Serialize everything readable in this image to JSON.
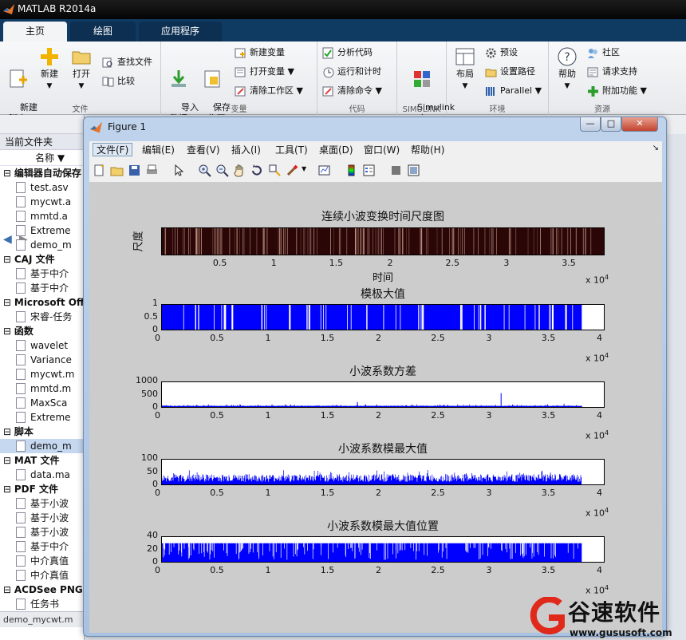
{
  "app": {
    "title": "MATLAB R2014a"
  },
  "tabs": [
    {
      "label": "主页"
    },
    {
      "label": "绘图"
    },
    {
      "label": "应用程序"
    }
  ],
  "ribbon": {
    "file": {
      "group": "文件",
      "new_script": "新建\n脚本",
      "new": "新建",
      "open": "打开",
      "find_files": "查找文件",
      "compare": "比较"
    },
    "variable": {
      "group": "变量",
      "import": "导入\n数据",
      "save_ws": "保存\n工作区",
      "new_var": "新建变量",
      "open_var": "打开变量",
      "clear_ws": "清除工作区"
    },
    "code": {
      "group": "代码",
      "analyze": "分析代码",
      "run_time": "运行和计时",
      "clear_cmd": "清除命令"
    },
    "simulink": {
      "group": "SIMULINK",
      "lib": "Simulink\n库"
    },
    "env": {
      "group": "环境",
      "layout": "布局",
      "prefs": "预设",
      "set_path": "设置路径",
      "parallel": "Parallel"
    },
    "resources": {
      "group": "资源",
      "help": "帮助",
      "community": "社区",
      "support": "请求支持",
      "addons": "附加功能"
    }
  },
  "left_panel": {
    "title": "当前文件夹",
    "col_name": "名称",
    "groups": [
      {
        "name": "编辑器自动保存",
        "files": [
          "test.asv",
          "mycwt.a",
          "mmtd.a",
          "Extreme",
          "demo_m"
        ]
      },
      {
        "name": "CAJ 文件",
        "files": [
          "基于中介",
          "基于中介"
        ]
      },
      {
        "name": "Microsoft Off",
        "files": [
          "宋睿-任务"
        ]
      },
      {
        "name": "函数",
        "files": [
          "wavelet",
          "Variance",
          "mycwt.m",
          "mmtd.m",
          "MaxSca",
          "Extreme"
        ]
      },
      {
        "name": "脚本",
        "files": [
          "demo_m"
        ]
      },
      {
        "name": "MAT 文件",
        "files": [
          "data.ma"
        ]
      },
      {
        "name": "PDF 文件",
        "files": [
          "基于小波",
          "基于小波",
          "基于小波",
          "基于中介",
          "中介真值",
          "中介真值"
        ]
      },
      {
        "name": "ACDSee PNG",
        "files": [
          "任务书"
        ]
      }
    ],
    "status": "demo_mycwt.m"
  },
  "figure": {
    "title": "Figure 1",
    "menu": [
      "文件(F)",
      "编辑(E)",
      "查看(V)",
      "插入(I)",
      "工具(T)",
      "桌面(D)",
      "窗口(W)",
      "帮助(H)"
    ]
  },
  "colors": {
    "plot_blue": "#0000ff",
    "scalogram_bg": "#2a0606",
    "ribbon_tab": "#0f3b63"
  },
  "chart_data": [
    {
      "type": "heatmap",
      "title": "连续小波变换时间尺度图",
      "xlabel": "时间",
      "ylabel": "尺度",
      "xlim": [
        0,
        38000
      ],
      "x_ticks": [
        "0.5",
        "1",
        "1.5",
        "2",
        "2.5",
        "3",
        "3.5"
      ],
      "x_tick_values": [
        5000,
        10000,
        15000,
        20000,
        25000,
        30000,
        35000
      ],
      "x_exponent": "x 10",
      "x_exponent_power": "4"
    },
    {
      "type": "bar",
      "title": "模极大值",
      "xlim": [
        0,
        40000
      ],
      "ylim": [
        0,
        1
      ],
      "y_ticks": [
        "0",
        "0.5",
        "1"
      ],
      "x_ticks": [
        "0",
        "0.5",
        "1",
        "1.5",
        "2",
        "2.5",
        "3",
        "3.5",
        "4"
      ],
      "data_end_x": 38000,
      "gaps_x": [
        3000,
        5600,
        5700,
        6300,
        6350,
        9000,
        11500,
        11550,
        13300,
        18500,
        23500,
        23600,
        27000,
        27100,
        28800,
        29200,
        34100,
        35300,
        35350,
        36500,
        36550
      ],
      "x_exponent": "x 10",
      "x_exponent_power": "4"
    },
    {
      "type": "bar",
      "title": "小波系数方差",
      "xlim": [
        0,
        40000
      ],
      "ylim": [
        0,
        1000
      ],
      "y_ticks": [
        "0",
        "500",
        "1000"
      ],
      "x_ticks": [
        "0",
        "0.5",
        "1",
        "1.5",
        "2",
        "2.5",
        "3",
        "3.5",
        "4"
      ],
      "baseline": 20,
      "spikes": [
        {
          "x": 17700,
          "y": 200
        },
        {
          "x": 30700,
          "y": 560
        },
        {
          "x": 36400,
          "y": 120
        }
      ],
      "x_exponent": "x 10",
      "x_exponent_power": "4"
    },
    {
      "type": "bar",
      "title": "小波系数模最大值",
      "xlim": [
        0,
        40000
      ],
      "ylim": [
        0,
        100
      ],
      "y_ticks": [
        "0",
        "50",
        "100"
      ],
      "x_ticks": [
        "0",
        "0.5",
        "1",
        "1.5",
        "2",
        "2.5",
        "3",
        "3.5",
        "4"
      ],
      "base_range": [
        10,
        45
      ],
      "data_end_x": 38000,
      "x_exponent": "x 10",
      "x_exponent_power": "4"
    },
    {
      "type": "bar",
      "title": "小波系数模最大值位置",
      "xlim": [
        0,
        40000
      ],
      "ylim": [
        0,
        40
      ],
      "y_ticks": [
        "0",
        "20",
        "40"
      ],
      "x_ticks": [
        "0",
        "0.5",
        "1",
        "1.5",
        "2",
        "2.5",
        "3",
        "3.5",
        "4"
      ],
      "fill_level": 30,
      "data_end_x": 38000,
      "x_exponent": "x 10",
      "x_exponent_power": "4"
    }
  ],
  "watermark": {
    "text": "谷速软件",
    "url": "www.gususoft.com"
  }
}
